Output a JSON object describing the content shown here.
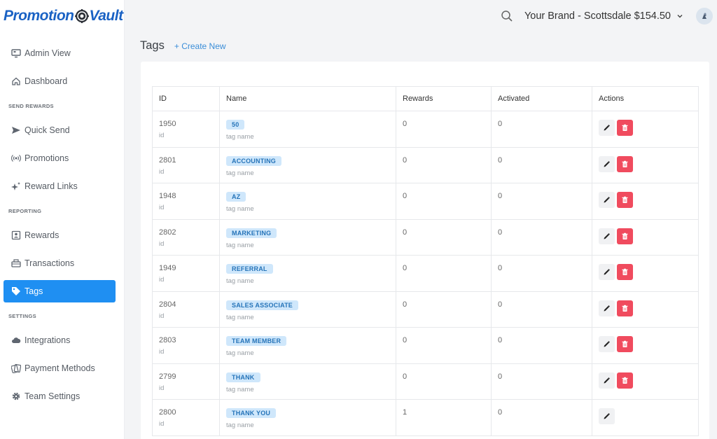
{
  "app": {
    "logo_left": "Promotion",
    "logo_right": "Vault"
  },
  "header": {
    "brand_label": "Your Brand - Scottsdale $154.50"
  },
  "sidebar": {
    "admin_view": "Admin View",
    "dashboard": "Dashboard",
    "send_rewards_label": "SEND REWARDS",
    "quick_send": "Quick Send",
    "promotions": "Promotions",
    "reward_links": "Reward Links",
    "reporting_label": "REPORTING",
    "rewards": "Rewards",
    "transactions": "Transactions",
    "tags": "Tags",
    "settings_label": "SETTINGS",
    "integrations": "Integrations",
    "payment_methods": "Payment Methods",
    "team_settings": "Team Settings"
  },
  "page": {
    "title": "Tags",
    "create_new": "+ Create New"
  },
  "table": {
    "headers": {
      "id": "ID",
      "name": "Name",
      "rewards": "Rewards",
      "activated": "Activated",
      "actions": "Actions"
    },
    "id_sub": "id",
    "name_sub": "tag name",
    "rows": [
      {
        "id": "1950",
        "name": "50",
        "rewards": "0",
        "activated": "0",
        "deletable": true
      },
      {
        "id": "2801",
        "name": "ACCOUNTING",
        "rewards": "0",
        "activated": "0",
        "deletable": true
      },
      {
        "id": "1948",
        "name": "AZ",
        "rewards": "0",
        "activated": "0",
        "deletable": true
      },
      {
        "id": "2802",
        "name": "MARKETING",
        "rewards": "0",
        "activated": "0",
        "deletable": true
      },
      {
        "id": "1949",
        "name": "REFERRAL",
        "rewards": "0",
        "activated": "0",
        "deletable": true
      },
      {
        "id": "2804",
        "name": "SALES ASSOCIATE",
        "rewards": "0",
        "activated": "0",
        "deletable": true
      },
      {
        "id": "2803",
        "name": "TEAM MEMBER",
        "rewards": "0",
        "activated": "0",
        "deletable": true
      },
      {
        "id": "2799",
        "name": "THANK",
        "rewards": "0",
        "activated": "0",
        "deletable": true
      },
      {
        "id": "2800",
        "name": "THANK YOU",
        "rewards": "1",
        "activated": "0",
        "deletable": false
      }
    ]
  },
  "icons": {
    "edit": "pencil-icon",
    "delete": "trash-icon"
  },
  "colors": {
    "accent": "#1f8ff2",
    "danger": "#f04b5e",
    "tag_bg": "#cfe7fb",
    "tag_text": "#2674b9",
    "logo": "#1a62c4"
  }
}
